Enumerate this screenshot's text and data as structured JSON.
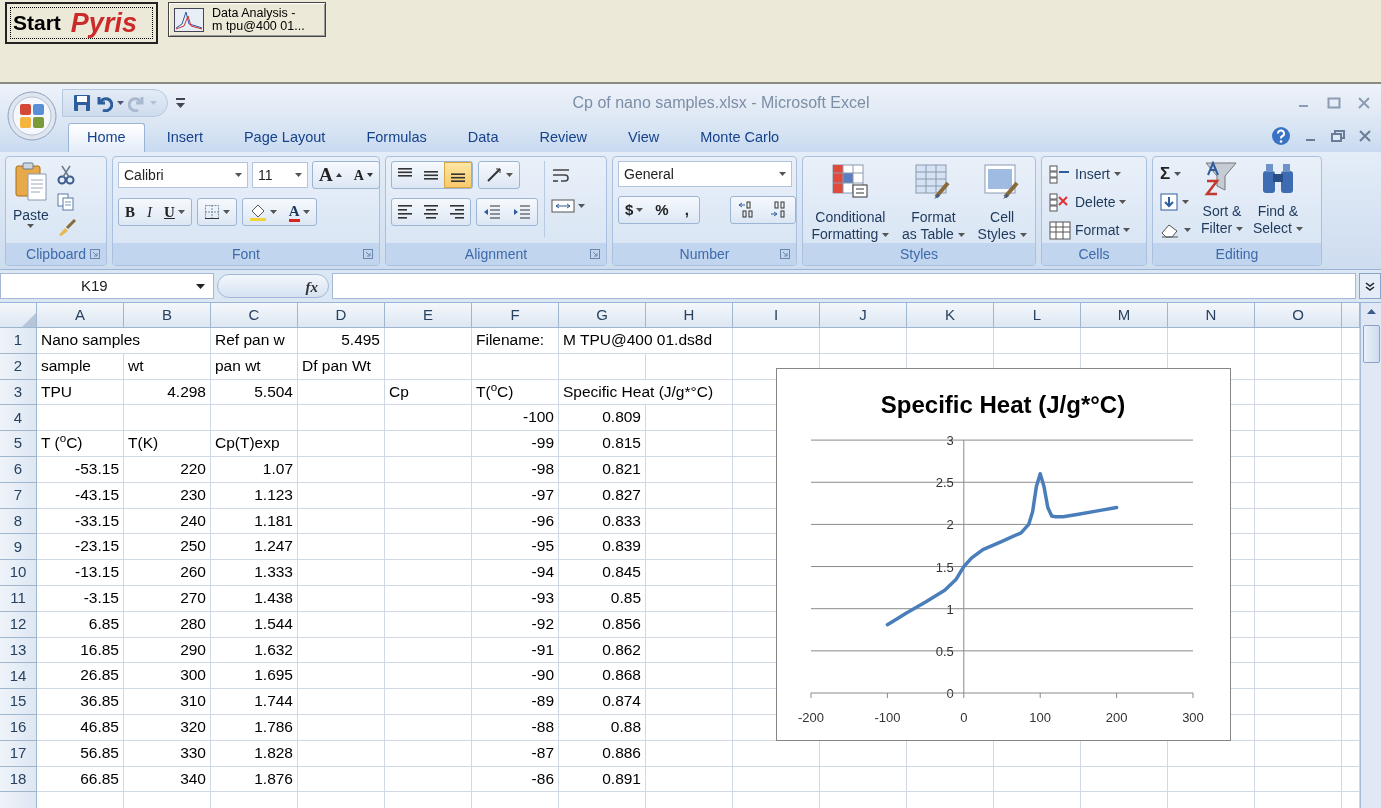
{
  "taskbar": {
    "start_button": {
      "label": "Start",
      "brand": "Pyris"
    },
    "task_buttons": [
      {
        "lines": [
          "Data Analysis -",
          "m tpu@400 01..."
        ]
      }
    ]
  },
  "window": {
    "title": "Cp of nano samples.xlsx - Microsoft Excel"
  },
  "quick_access": [
    {
      "kind": "save",
      "disabled": false
    },
    {
      "kind": "undo",
      "disabled": false
    },
    {
      "kind": "redo",
      "disabled": true
    }
  ],
  "tabs": [
    {
      "label": "Home",
      "selected": true
    },
    {
      "label": "Insert",
      "selected": false
    },
    {
      "label": "Page Layout",
      "selected": false
    },
    {
      "label": "Formulas",
      "selected": false
    },
    {
      "label": "Data",
      "selected": false
    },
    {
      "label": "Review",
      "selected": false
    },
    {
      "label": "View",
      "selected": false
    },
    {
      "label": "Monte Carlo",
      "selected": false
    }
  ],
  "ribbon": {
    "clipboard": {
      "label": "Clipboard",
      "paste": "Paste"
    },
    "font": {
      "label": "Font",
      "font_name": "Calibri",
      "font_size": "11",
      "grow": "A",
      "shrink": "A",
      "bold": "B",
      "italic": "I",
      "underline": "U",
      "font_color": "A"
    },
    "alignment": {
      "label": "Alignment",
      "vertical_align": [
        {
          "kind": "top",
          "selected": false
        },
        {
          "kind": "middle",
          "selected": false
        },
        {
          "kind": "bottom",
          "selected": true
        }
      ]
    },
    "number": {
      "label": "Number",
      "format": "General",
      "currency": "$",
      "percent": "%",
      "comma": ","
    },
    "styles": {
      "label": "Styles",
      "buttons": [
        {
          "kind": "conditional",
          "lines": [
            "Conditional",
            "Formatting"
          ]
        },
        {
          "kind": "table",
          "lines": [
            "Format",
            "as Table"
          ]
        },
        {
          "kind": "cell",
          "lines": [
            "Cell",
            "Styles"
          ]
        }
      ]
    },
    "cells": {
      "label": "Cells",
      "buttons": [
        {
          "kind": "insert",
          "label": "Insert"
        },
        {
          "kind": "delete",
          "label": "Delete"
        },
        {
          "kind": "format",
          "label": "Format"
        }
      ]
    },
    "editing": {
      "label": "Editing",
      "sum": "Σ",
      "buttons": [
        {
          "kind": "sort",
          "lines": [
            "Sort &",
            "Filter"
          ]
        },
        {
          "kind": "find",
          "lines": [
            "Find &",
            "Select"
          ]
        }
      ]
    }
  },
  "formula_bar": {
    "name_box": "K19",
    "function_label": "fx"
  },
  "sheet": {
    "columns": [
      "A",
      "B",
      "C",
      "D",
      "E",
      "F",
      "G",
      "H",
      "I",
      "J",
      "K",
      "L",
      "M",
      "N",
      "O"
    ],
    "rows": [
      {
        "number": "1",
        "cells": [
          {
            "text": "Nano samples",
            "kind": "text"
          },
          null,
          {
            "text": "Ref pan w",
            "kind": "text"
          },
          {
            "text": "5.495",
            "kind": "number"
          },
          null,
          {
            "text": "Filename:",
            "kind": "text"
          },
          {
            "text": "M TPU@400 01.ds8d",
            "kind": "text"
          }
        ]
      },
      {
        "number": "2",
        "cells": [
          {
            "text": "sample",
            "kind": "text"
          },
          {
            "text": "wt",
            "kind": "text"
          },
          {
            "text": "pan wt",
            "kind": "text"
          },
          {
            "text": "Df pan Wt",
            "kind": "text"
          }
        ]
      },
      {
        "number": "3",
        "cells": [
          {
            "text": "TPU",
            "kind": "text"
          },
          {
            "text": "4.298",
            "kind": "number"
          },
          {
            "text": "5.504",
            "kind": "number"
          },
          null,
          {
            "text": "Cp",
            "kind": "text"
          },
          {
            "text": "T($^{o}$C)",
            "kind": "text"
          },
          {
            "text": "Specific Heat (J/g*°C)",
            "kind": "text"
          }
        ]
      },
      {
        "number": "4",
        "cells": [
          null,
          null,
          null,
          null,
          null,
          {
            "text": "-100",
            "kind": "number"
          },
          {
            "text": "0.809",
            "kind": "number"
          }
        ]
      },
      {
        "number": "5",
        "cells": [
          {
            "text": "T ($^{o}$C)",
            "kind": "text"
          },
          {
            "text": "T(K)",
            "kind": "text"
          },
          {
            "text": "Cp(T)exp",
            "kind": "text"
          },
          null,
          null,
          {
            "text": "-99",
            "kind": "number"
          },
          {
            "text": "0.815",
            "kind": "number"
          }
        ]
      },
      {
        "number": "6",
        "cells": [
          {
            "text": "-53.15",
            "kind": "number"
          },
          {
            "text": "220",
            "kind": "number"
          },
          {
            "text": "1.07",
            "kind": "number"
          },
          null,
          null,
          {
            "text": "-98",
            "kind": "number"
          },
          {
            "text": "0.821",
            "kind": "number"
          }
        ]
      },
      {
        "number": "7",
        "cells": [
          {
            "text": "-43.15",
            "kind": "number"
          },
          {
            "text": "230",
            "kind": "number"
          },
          {
            "text": "1.123",
            "kind": "number"
          },
          null,
          null,
          {
            "text": "-97",
            "kind": "number"
          },
          {
            "text": "0.827",
            "kind": "number"
          }
        ]
      },
      {
        "number": "8",
        "cells": [
          {
            "text": "-33.15",
            "kind": "number"
          },
          {
            "text": "240",
            "kind": "number"
          },
          {
            "text": "1.181",
            "kind": "number"
          },
          null,
          null,
          {
            "text": "-96",
            "kind": "number"
          },
          {
            "text": "0.833",
            "kind": "number"
          }
        ]
      },
      {
        "number": "9",
        "cells": [
          {
            "text": "-23.15",
            "kind": "number"
          },
          {
            "text": "250",
            "kind": "number"
          },
          {
            "text": "1.247",
            "kind": "number"
          },
          null,
          null,
          {
            "text": "-95",
            "kind": "number"
          },
          {
            "text": "0.839",
            "kind": "number"
          }
        ]
      },
      {
        "number": "10",
        "cells": [
          {
            "text": "-13.15",
            "kind": "number"
          },
          {
            "text": "260",
            "kind": "number"
          },
          {
            "text": "1.333",
            "kind": "number"
          },
          null,
          null,
          {
            "text": "-94",
            "kind": "number"
          },
          {
            "text": "0.845",
            "kind": "number"
          }
        ]
      },
      {
        "number": "11",
        "cells": [
          {
            "text": "-3.15",
            "kind": "number"
          },
          {
            "text": "270",
            "kind": "number"
          },
          {
            "text": "1.438",
            "kind": "number"
          },
          null,
          null,
          {
            "text": "-93",
            "kind": "number"
          },
          {
            "text": "0.85",
            "kind": "number"
          }
        ]
      },
      {
        "number": "12",
        "cells": [
          {
            "text": "6.85",
            "kind": "number"
          },
          {
            "text": "280",
            "kind": "number"
          },
          {
            "text": "1.544",
            "kind": "number"
          },
          null,
          null,
          {
            "text": "-92",
            "kind": "number"
          },
          {
            "text": "0.856",
            "kind": "number"
          }
        ]
      },
      {
        "number": "13",
        "cells": [
          {
            "text": "16.85",
            "kind": "number"
          },
          {
            "text": "290",
            "kind": "number"
          },
          {
            "text": "1.632",
            "kind": "number"
          },
          null,
          null,
          {
            "text": "-91",
            "kind": "number"
          },
          {
            "text": "0.862",
            "kind": "number"
          }
        ]
      },
      {
        "number": "14",
        "cells": [
          {
            "text": "26.85",
            "kind": "number"
          },
          {
            "text": "300",
            "kind": "number"
          },
          {
            "text": "1.695",
            "kind": "number"
          },
          null,
          null,
          {
            "text": "-90",
            "kind": "number"
          },
          {
            "text": "0.868",
            "kind": "number"
          }
        ]
      },
      {
        "number": "15",
        "cells": [
          {
            "text": "36.85",
            "kind": "number"
          },
          {
            "text": "310",
            "kind": "number"
          },
          {
            "text": "1.744",
            "kind": "number"
          },
          null,
          null,
          {
            "text": "-89",
            "kind": "number"
          },
          {
            "text": "0.874",
            "kind": "number"
          }
        ]
      },
      {
        "number": "16",
        "cells": [
          {
            "text": "46.85",
            "kind": "number"
          },
          {
            "text": "320",
            "kind": "number"
          },
          {
            "text": "1.786",
            "kind": "number"
          },
          null,
          null,
          {
            "text": "-88",
            "kind": "number"
          },
          {
            "text": "0.88",
            "kind": "number"
          }
        ]
      },
      {
        "number": "17",
        "cells": [
          {
            "text": "56.85",
            "kind": "number"
          },
          {
            "text": "330",
            "kind": "number"
          },
          {
            "text": "1.828",
            "kind": "number"
          },
          null,
          null,
          {
            "text": "-87",
            "kind": "number"
          },
          {
            "text": "0.886",
            "kind": "number"
          }
        ]
      },
      {
        "number": "18",
        "cells": [
          {
            "text": "66.85",
            "kind": "number"
          },
          {
            "text": "340",
            "kind": "number"
          },
          {
            "text": "1.876",
            "kind": "number"
          },
          null,
          null,
          {
            "text": "-86",
            "kind": "number"
          },
          {
            "text": "0.891",
            "kind": "number"
          }
        ]
      }
    ],
    "chart": {
      "chart_data": {
        "type": "line",
        "title": "Specific Heat (J/g*°C)",
        "x": [
          -100,
          -75,
          -50,
          -25,
          -10,
          0,
          10,
          25,
          50,
          75,
          85,
          90,
          95,
          100,
          105,
          110,
          115,
          120,
          130,
          150,
          175,
          200
        ],
        "grid": true,
        "series": [
          {
            "color": "#4a7ebb",
            "values": [
              0.81,
              0.95,
              1.08,
              1.22,
              1.35,
              1.5,
              1.6,
              1.7,
              1.8,
              1.9,
              2.0,
              2.15,
              2.45,
              2.6,
              2.45,
              2.2,
              2.1,
              2.09,
              2.09,
              2.12,
              2.16,
              2.2
            ]
          }
        ],
        "xlim": [
          -200,
          300
        ],
        "ylim": [
          0,
          3
        ],
        "xticks": [
          -200,
          -100,
          0,
          100,
          200,
          300
        ],
        "yticks": [
          0,
          {
            "value": 0.5,
            "label": "0.5"
          },
          1,
          {
            "value": 1.5,
            "label": "1.5"
          },
          2,
          {
            "value": 2.5,
            "label": "2.5"
          },
          3
        ]
      }
    }
  }
}
